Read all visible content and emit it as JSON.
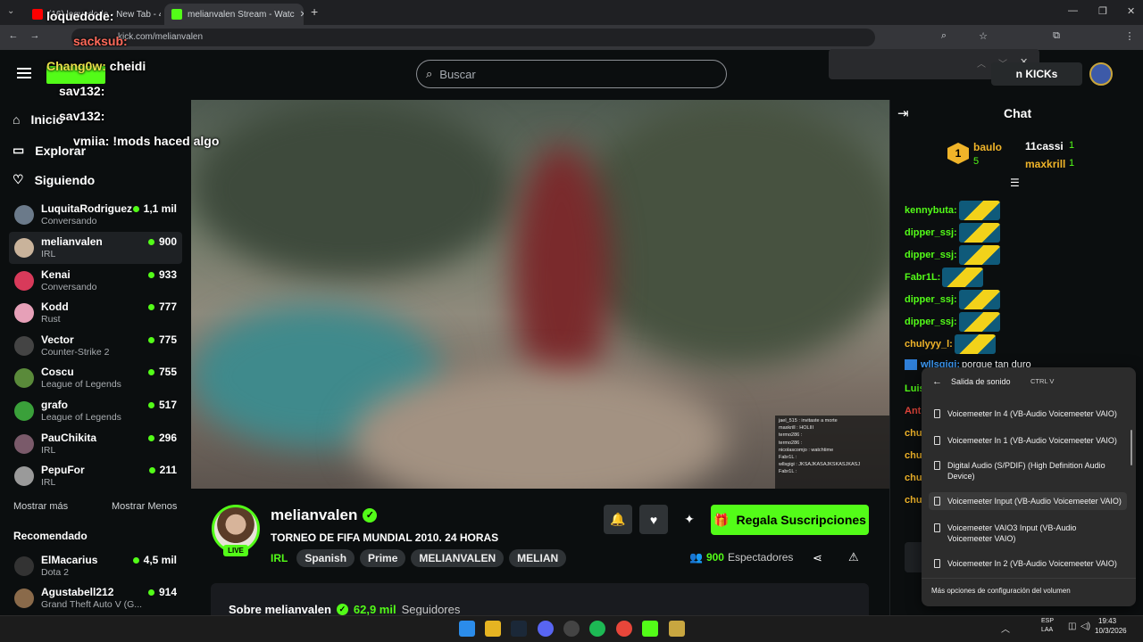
{
  "browser": {
    "tab1_title": "(16) loquedode - New Tab - 456...",
    "tab2_title": "melianvalen Stream - Watc",
    "url": "kick.com/melianvalen"
  },
  "header": {
    "search_placeholder": "Buscar",
    "kicks_label": "n KICKs"
  },
  "overlay_chat": [
    {
      "user": "loquedode:",
      "text": ""
    },
    {
      "user": "sacksub:",
      "text": ""
    },
    {
      "user": "Chang0w:",
      "text": "cheidi"
    },
    {
      "user": "sav132:",
      "text": ""
    },
    {
      "user": "sav132:",
      "text": ""
    },
    {
      "user": "vmiia:",
      "text": "!mods haced algo"
    }
  ],
  "sidebar": {
    "nav": [
      {
        "label": "Inicio"
      },
      {
        "label": "Explorar"
      },
      {
        "label": "Siguiendo"
      }
    ],
    "following": [
      {
        "name": "LuquitaRodriguez",
        "game": "Conversando",
        "viewers": "1,1 mil"
      },
      {
        "name": "melianvalen",
        "game": "IRL",
        "viewers": "900"
      },
      {
        "name": "Kenai",
        "game": "Conversando",
        "viewers": "933"
      },
      {
        "name": "Kodd",
        "game": "Rust",
        "viewers": "777"
      },
      {
        "name": "Vector",
        "game": "Counter-Strike 2",
        "viewers": "775"
      },
      {
        "name": "Coscu",
        "game": "League of Legends",
        "viewers": "755"
      },
      {
        "name": "grafo",
        "game": "League of Legends",
        "viewers": "517"
      },
      {
        "name": "PauChikita",
        "game": "IRL",
        "viewers": "296"
      },
      {
        "name": "PepuFor",
        "game": "IRL",
        "viewers": "211"
      }
    ],
    "show_more": "Mostrar más",
    "show_less": "Mostrar Menos",
    "recommended_title": "Recomendado",
    "recommended": [
      {
        "name": "ElMacarius",
        "game": "Dota 2",
        "viewers": "4,5 mil"
      },
      {
        "name": "Agustabell212",
        "game": "Grand Theft Auto V (G...",
        "viewers": "914"
      }
    ]
  },
  "video_overlay_chat": [
    "jael_515 : invitaste a morte",
    "maxkrill : HOLIII",
    "termo286 :",
    "termo286 :",
    "nicolascomjo : watchtime",
    "Fabr1L :",
    "wllsgigi : JKSAJKASAJKSKASJKASJ",
    "Fabr1L :"
  ],
  "stream": {
    "channel": "melianvalen",
    "live_label": "LIVE",
    "title": "TORNEO DE FIFA MUNDIAL 2010. 24 HORAS",
    "category": "IRL",
    "tags": [
      "Spanish",
      "Prime",
      "MELIANVALEN",
      "MELIAN"
    ],
    "gift_label": "Regala Suscripciones",
    "viewers_count": "900",
    "viewers_label": "Espectadores",
    "about": "Sobre melianvalen",
    "followers_count": "62,9 mil",
    "followers_label": "Seguidores"
  },
  "chat": {
    "title": "Chat",
    "leaderboard": [
      {
        "rank": "1",
        "name": "baulo",
        "count": "5"
      },
      {
        "name": "11cassi",
        "count": "1"
      },
      {
        "name": "maxkrill",
        "count": "1"
      }
    ],
    "messages": [
      {
        "user": "kennybuta:",
        "text": ""
      },
      {
        "user": "dipper_ssj:",
        "text": ""
      },
      {
        "user": "dipper_ssj:",
        "text": ""
      },
      {
        "user": "Fabr1L:",
        "text": ""
      },
      {
        "user": "dipper_ssj:",
        "text": ""
      },
      {
        "user": "dipper_ssj:",
        "text": ""
      },
      {
        "user": "chulyyy_l:",
        "text": ""
      },
      {
        "user": "wllsgigi:",
        "text": " porque tan duro"
      }
    ],
    "partial_users": [
      "Luis",
      "Ant",
      "chu",
      "chu",
      "chu",
      "chu"
    ]
  },
  "sound_panel": {
    "title": "Salida de sonido",
    "shortcut": "CTRL V",
    "devices": [
      "Voicemeeter In 4 (VB-Audio Voicemeeter VAIO)",
      "Voicemeeter In 1 (VB-Audio Voicemeeter VAIO)",
      "Digital Audio (S/PDIF) (High Definition Audio Device)",
      "Voicemeeter Input (VB-Audio Voicemeeter VAIO)",
      "Voicemeeter VAIO3 Input (VB-Audio Voicemeeter VAIO)",
      "Voicemeeter In 2 (VB-Audio Voicemeeter VAIO)"
    ],
    "more": "Más opciones de configuración del volumen"
  },
  "taskbar": {
    "lang1": "ESP",
    "lang2": "LAA",
    "time": "19:43",
    "date": "10/3/2026"
  },
  "colors": {
    "accent": "#53fc18",
    "bg": "#0b0e0f"
  }
}
